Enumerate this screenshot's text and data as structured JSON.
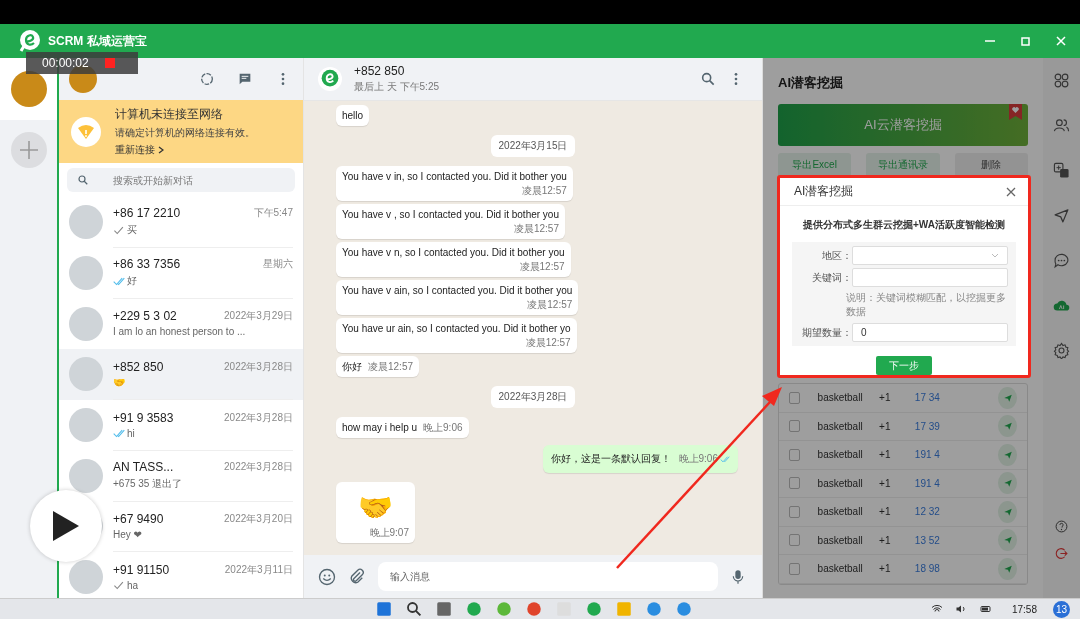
{
  "recorder": {
    "time": "00:00:02"
  },
  "app": {
    "title": "SCRM 私域运营宝"
  },
  "accounts": [
    {
      "selected": true
    }
  ],
  "network_banner": {
    "title": "计算机未连接至网络",
    "text": "请确定计算机的网络连接有效。",
    "link": "重新连接"
  },
  "search": {
    "placeholder": "搜索或开始新对话"
  },
  "chats": [
    {
      "name": "+86 17 2210",
      "preview": "买",
      "time": "下午5:47",
      "kind": "sent",
      "selected": false
    },
    {
      "name": "+86 33 7356",
      "preview": "好",
      "time": "星期六",
      "kind": "read",
      "selected": false
    },
    {
      "name": "+229 5 3 02",
      "preview": "I am lo an honest person to ...",
      "time": "2022年3月29日",
      "kind": "received",
      "selected": false
    },
    {
      "name": "+852 850",
      "preview": "🤝",
      "time": "2022年3月28日",
      "kind": "received",
      "selected": true
    },
    {
      "name": "+91 9 3583",
      "preview": "hi",
      "time": "2022年3月28日",
      "kind": "read",
      "selected": false
    },
    {
      "name": "AN TASS...",
      "preview": "+675 35 退出了",
      "time": "2022年3月28日",
      "kind": "received",
      "selected": false
    },
    {
      "name": "+67 9490",
      "preview": "Hey ❤",
      "time": "2022年3月20日",
      "kind": "received",
      "selected": false
    },
    {
      "name": "+91 91150",
      "preview": "ha",
      "time": "2022年3月11日",
      "kind": "sent",
      "selected": false
    }
  ],
  "chat": {
    "name": "+852 850",
    "status": "最后上 天 下午5:25",
    "input_placeholder": "输入消息",
    "messages": [
      {
        "kind": "in",
        "text": "hello"
      },
      {
        "kind": "date",
        "text": "2022年3月15日"
      },
      {
        "kind": "in",
        "text": "You have v in, so I contacted you. Did it bother you",
        "time": "凌晨12:57"
      },
      {
        "kind": "in",
        "text": "You have v , so I contacted you. Did it bother you",
        "time": "凌晨12:57"
      },
      {
        "kind": "in",
        "text": "You have v n, so I contacted you. Did it bother you",
        "time": "凌晨12:57"
      },
      {
        "kind": "in",
        "text": "You have v ain, so I contacted you. Did it bother you",
        "time": "凌晨12:57"
      },
      {
        "kind": "in",
        "text": "You have ur ain, so I contacted you. Did it bother yo",
        "time": "凌晨12:57"
      },
      {
        "kind": "in",
        "text": "你好",
        "time": "凌晨12:57"
      },
      {
        "kind": "date",
        "text": "2022年3月28日"
      },
      {
        "kind": "in",
        "text": "how may i help u",
        "time": "晚上9:06"
      },
      {
        "kind": "out",
        "text": "你好，这是一条默认回复！",
        "time": "晚上9:06"
      },
      {
        "kind": "emoji",
        "text": "🤝",
        "time": "晚上9:07"
      }
    ]
  },
  "ai_panel": {
    "title": "AI潜客挖掘",
    "banner": "AI云潜客挖掘",
    "buttons": [
      "导出Excel",
      "导出通讯录",
      "删除"
    ],
    "rows": [
      {
        "checked": false,
        "name": "basketball",
        "code": "+1",
        "phone": "17 34"
      },
      {
        "checked": false,
        "name": "basketball",
        "code": "+1",
        "phone": "17 39"
      },
      {
        "checked": false,
        "name": "basketball",
        "code": "+1",
        "phone": "191 4"
      },
      {
        "checked": false,
        "name": "basketball",
        "code": "+1",
        "phone": "191 4"
      },
      {
        "checked": false,
        "name": "basketball",
        "code": "+1",
        "phone": "12 32"
      },
      {
        "checked": false,
        "name": "basketball",
        "code": "+1",
        "phone": "13 52"
      },
      {
        "checked": false,
        "name": "basketball",
        "code": "+1",
        "phone": "18 98"
      }
    ]
  },
  "dialog": {
    "title": "AI潜客挖掘",
    "subtitle": "提供分布式多生群云挖掘+WA活跃度智能检测",
    "fields": [
      {
        "label": "地区：",
        "kind": "select"
      },
      {
        "label": "关键词：",
        "kind": "text"
      },
      {
        "label": "期望数量：",
        "kind": "text",
        "value": "0"
      }
    ],
    "hint": "说明：关键词模糊匹配，以挖掘更多数据",
    "button": "下一步"
  },
  "taskbar": {
    "time": "17:58",
    "badge": "13"
  }
}
